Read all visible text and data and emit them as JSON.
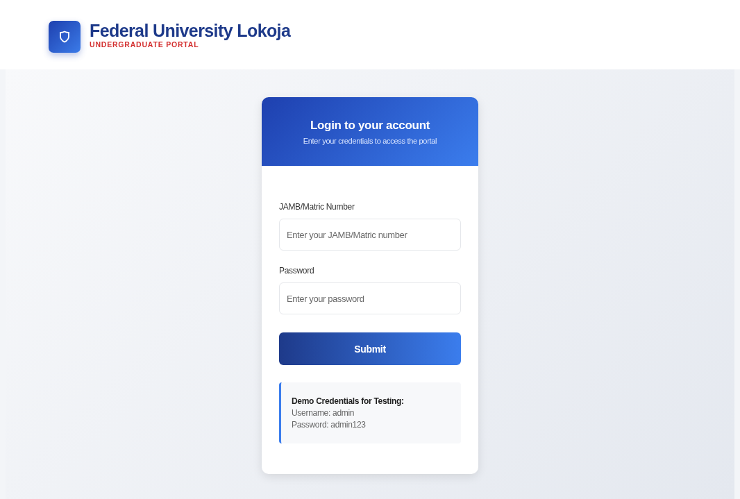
{
  "header": {
    "title": "Federal University Lokoja",
    "subtitle": "UNDERGRADUATE PORTAL"
  },
  "login_card": {
    "title": "Login to your account",
    "subtitle": "Enter your credentials to access the portal",
    "fields": [
      {
        "label": "JAMB/Matric Number",
        "placeholder": "Enter your JAMB/Matric number"
      },
      {
        "label": "Password",
        "placeholder": "Enter your password"
      }
    ],
    "submit_button": "Submit",
    "demo": {
      "title": "Demo Credentials for Testing:",
      "lines": [
        "Username: admin",
        "Password: admin123"
      ]
    }
  }
}
